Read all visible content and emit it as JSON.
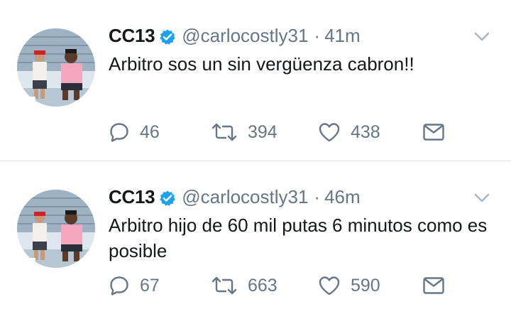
{
  "tweets": [
    {
      "name": "CC13",
      "handle": "@carlocostly31",
      "separator": "·",
      "time": "41m",
      "text": "Arbitro sos un sin vergüenza cabron!!",
      "replies": "46",
      "retweets": "394",
      "likes": "438"
    },
    {
      "name": "CC13",
      "handle": "@carlocostly31",
      "separator": "·",
      "time": "46m",
      "text": "Arbitro hijo de 60 mil putas 6 minutos como es posible",
      "replies": "67",
      "retweets": "663",
      "likes": "590"
    }
  ],
  "colors": {
    "verified": "#1da1f2",
    "secondary_text": "#657786",
    "divider": "#e6ecf0"
  },
  "icons": [
    "verified-badge-icon",
    "chevron-down-icon",
    "reply-icon",
    "retweet-icon",
    "like-icon",
    "direct-message-icon"
  ]
}
